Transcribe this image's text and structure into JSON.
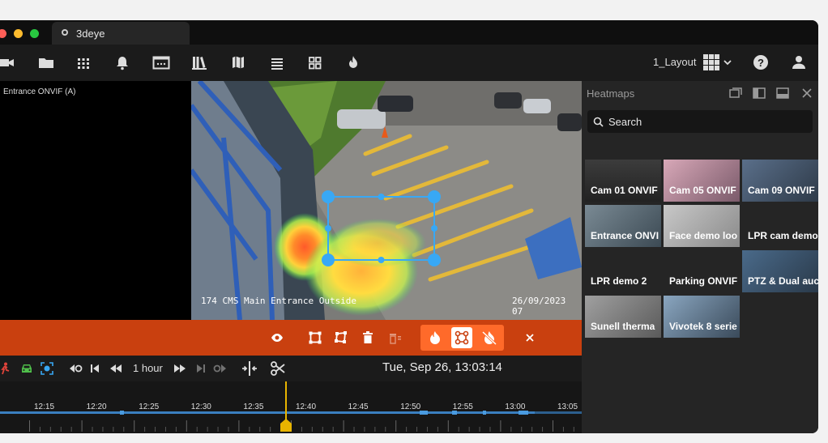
{
  "app": {
    "tab_title": "3deye"
  },
  "toolbar": {
    "layout_label": "1_Layout"
  },
  "left_pane": {
    "camera_label": "Entrance ONVIF (A)"
  },
  "video": {
    "osd_name": "174 CMS Main Entrance Outside",
    "osd_date": "26/09/2023 07"
  },
  "controls": {
    "range_label": "1 hour",
    "datetime": "Tue, Sep 26, 13:03:14"
  },
  "timeline": {
    "ticks": [
      "12:15",
      "12:20",
      "12:25",
      "12:30",
      "12:35",
      "12:40",
      "12:45",
      "12:50",
      "12:55",
      "13:00",
      "13:05"
    ]
  },
  "heatmaps": {
    "title": "Heatmaps",
    "search_placeholder": "Search",
    "tiles": [
      {
        "name": "Cam 01 ONVIF"
      },
      {
        "name": "Cam 05 ONVIF"
      },
      {
        "name": "Cam 09 ONVIF"
      },
      {
        "name": "Entrance ONVI"
      },
      {
        "name": "Face demo loo"
      },
      {
        "name": "LPR cam demo"
      },
      {
        "name": "LPR demo 2"
      },
      {
        "name": "Parking ONVIF"
      },
      {
        "name": "PTZ & Dual auc"
      },
      {
        "name": "Sunell therma"
      },
      {
        "name": "Vivotek 8 serie"
      }
    ]
  },
  "colors": {
    "accent_orange": "#c9400f",
    "selection_blue": "#38a8f5",
    "playhead": "#e8b400"
  }
}
